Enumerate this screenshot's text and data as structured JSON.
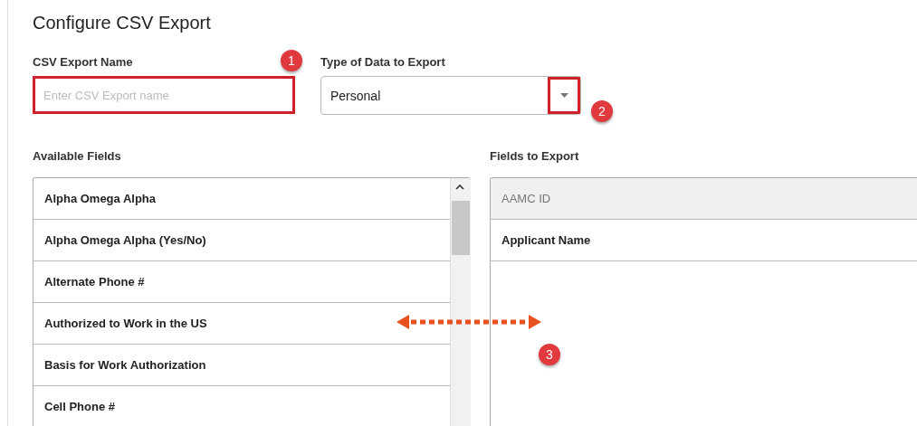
{
  "title": "Configure CSV Export",
  "export_name": {
    "label": "CSV Export Name",
    "placeholder": "Enter CSV Export name",
    "highlighted": true
  },
  "data_type": {
    "label": "Type of Data to Export",
    "value": "Personal",
    "caret_highlighted": true
  },
  "available_fields": {
    "label": "Available Fields",
    "items": [
      {
        "label": "Alpha Omega Alpha"
      },
      {
        "label": "Alpha Omega Alpha (Yes/No)"
      },
      {
        "label": "Alternate Phone #"
      },
      {
        "label": "Authorized to Work in the US"
      },
      {
        "label": "Basis for Work Authorization"
      },
      {
        "label": "Cell Phone #"
      }
    ]
  },
  "fields_to_export": {
    "label": "Fields to Export",
    "items": [
      {
        "label": "AAMC ID",
        "disabled": true
      },
      {
        "label": "Applicant Name",
        "disabled": false
      }
    ]
  },
  "annotations": [
    {
      "number": "1"
    },
    {
      "number": "2"
    },
    {
      "number": "3"
    }
  ]
}
